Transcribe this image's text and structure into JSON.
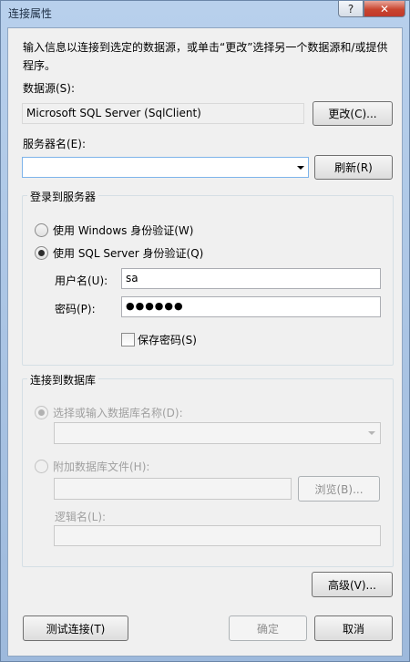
{
  "window": {
    "title": "连接属性",
    "help_glyph": "?",
    "close_glyph": "✕"
  },
  "intro": "输入信息以连接到选定的数据源，或单击“更改”选择另一个数据源和/或提供程序。",
  "datasource": {
    "label": "数据源(S):",
    "value": "Microsoft SQL Server (SqlClient)",
    "change_button": "更改(C)..."
  },
  "server": {
    "label": "服务器名(E):",
    "value": "",
    "refresh_button": "刷新(R)"
  },
  "login": {
    "group_title": "登录到服务器",
    "windows_auth": "使用 Windows 身份验证(W)",
    "sql_auth": "使用 SQL Server 身份验证(Q)",
    "selected": "sql_auth",
    "username_label": "用户名(U):",
    "username": "sa",
    "password_label": "密码(P):",
    "password_mask": "●●●●●●",
    "save_password": "保存密码(S)",
    "save_password_checked": false
  },
  "database": {
    "group_title": "连接到数据库",
    "select_db": "选择或输入数据库名称(D):",
    "select_db_value": "",
    "attach_file": "附加数据库文件(H):",
    "attach_file_value": "",
    "browse_button": "浏览(B)...",
    "logical_name_label": "逻辑名(L):",
    "logical_name_value": ""
  },
  "buttons": {
    "advanced": "高级(V)...",
    "test": "测试连接(T)",
    "ok": "确定",
    "cancel": "取消"
  }
}
